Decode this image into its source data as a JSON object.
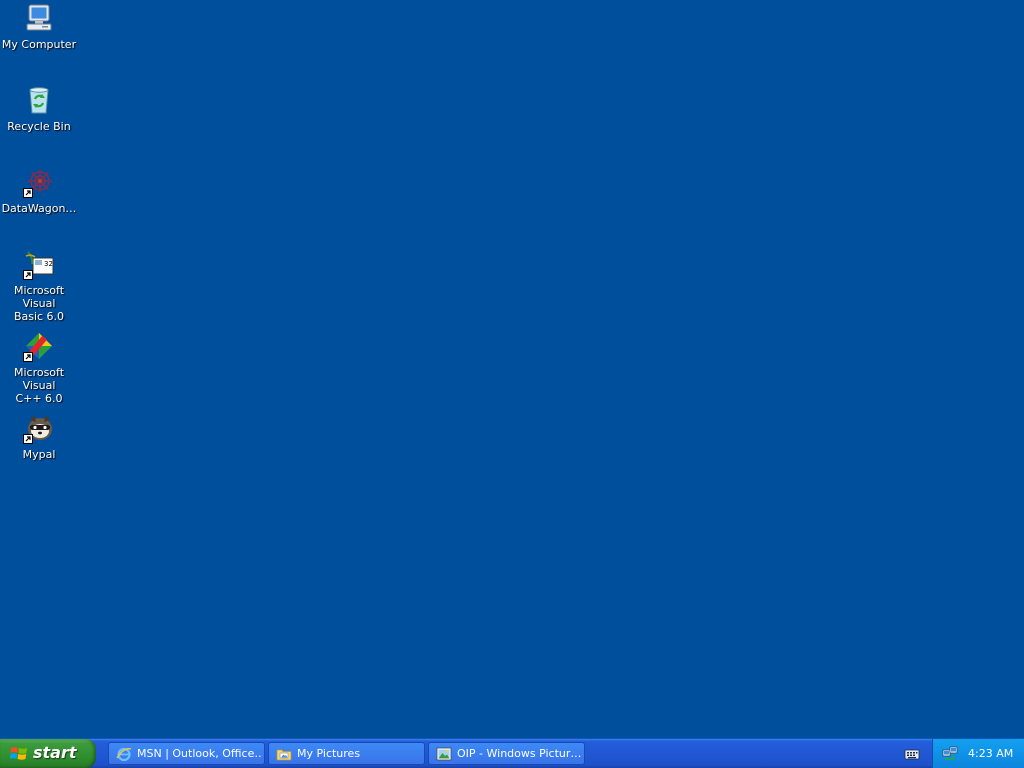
{
  "desktop": {
    "background_color": "#004f9c",
    "icons": [
      {
        "label": "My Computer",
        "icon": "my-computer-icon"
      },
      {
        "label": "Recycle Bin",
        "icon": "recycle-bin-icon"
      },
      {
        "label": "DataWagon…",
        "icon": "datawagon-icon"
      },
      {
        "label": "Microsoft Visual\nBasic 6.0",
        "icon": "visual-basic-icon"
      },
      {
        "label": "Microsoft Visual\nC++ 6.0",
        "icon": "visual-cpp-icon"
      },
      {
        "label": "Mypal",
        "icon": "mypal-icon"
      }
    ]
  },
  "taskbar": {
    "start_label": "start",
    "tasks": [
      {
        "label": "MSN | Outlook, Office…",
        "icon": "internet-explorer-icon"
      },
      {
        "label": "My Pictures",
        "icon": "folder-icon"
      },
      {
        "label": "OIP - Windows Pictur…",
        "icon": "picture-viewer-icon"
      }
    ],
    "tray": {
      "clock": "4:23 AM"
    }
  }
}
